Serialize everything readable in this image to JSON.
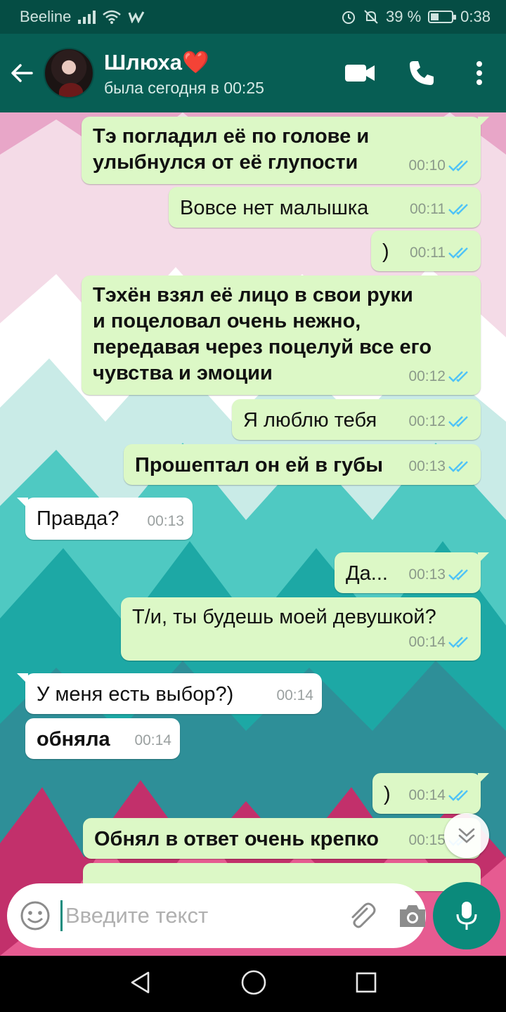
{
  "status_bar": {
    "carrier": "Beeline",
    "battery_percent": "39 %",
    "battery_level": 0.39,
    "time": "0:38"
  },
  "header": {
    "contact_name": "Шлюха❤️",
    "contact_status": "была сегодня в 00:25"
  },
  "messages": [
    {
      "dir": "out",
      "bold": true,
      "lines": [
        "Тэ погладил её по голове и",
        "улыбнулся от её глупости"
      ],
      "time": "00:10",
      "ticks": "✓✓"
    },
    {
      "dir": "out",
      "bold": false,
      "lines": [
        "Вовсе нет малышка"
      ],
      "time": "00:11",
      "ticks": "✓✓"
    },
    {
      "dir": "out",
      "bold": false,
      "lines": [
        ")"
      ],
      "time": "00:11",
      "ticks": "✓✓"
    },
    {
      "dir": "out",
      "bold": true,
      "lines": [
        "Тэхён взял её лицо в свои руки",
        "и поцеловал очень нежно,",
        "передавая через поцелуй все его",
        "чувства и эмоции"
      ],
      "time": "00:12",
      "ticks": "✓✓"
    },
    {
      "dir": "out",
      "bold": false,
      "lines": [
        "Я люблю тебя"
      ],
      "time": "00:12",
      "ticks": "✓✓"
    },
    {
      "dir": "out",
      "bold": true,
      "lines": [
        "Прошептал он ей в губы"
      ],
      "time": "00:13",
      "ticks": "✓✓"
    },
    {
      "dir": "in",
      "bold": false,
      "lines": [
        "Правда?"
      ],
      "time": "00:13"
    },
    {
      "dir": "out",
      "bold": false,
      "lines": [
        "Да..."
      ],
      "time": "00:13",
      "ticks": "✓✓"
    },
    {
      "dir": "out",
      "bold": false,
      "lines": [
        "Т/и, ты будешь моей девушкой?"
      ],
      "time": "00:14",
      "ticks": "✓✓"
    },
    {
      "dir": "in",
      "bold": false,
      "lines": [
        "У меня есть выбор?)"
      ],
      "time": "00:14"
    },
    {
      "dir": "in",
      "bold": true,
      "lines": [
        "обняла"
      ],
      "time": "00:14"
    },
    {
      "dir": "out",
      "bold": false,
      "lines": [
        ")"
      ],
      "time": "00:14",
      "ticks": "✓✓"
    },
    {
      "dir": "out",
      "bold": true,
      "lines": [
        "Обнял в ответ очень крепко"
      ],
      "time": "00:15",
      "ticks": "✓✓"
    }
  ],
  "composer": {
    "placeholder": "Введите текст"
  },
  "colors": {
    "header": "#075e54",
    "status_bar": "#054d44",
    "outgoing_bubble": "#dcf8c6",
    "incoming_bubble": "#ffffff",
    "tick_read": "#4fc3f7",
    "mic_button": "#0b8a7b"
  },
  "icons": {
    "back": "arrow-left",
    "video": "video-camera",
    "call": "phone",
    "menu": "more-vertical",
    "emoji": "smiley",
    "attach": "paperclip",
    "camera": "camera",
    "mic": "microphone",
    "scroll": "double-chevron-down"
  }
}
